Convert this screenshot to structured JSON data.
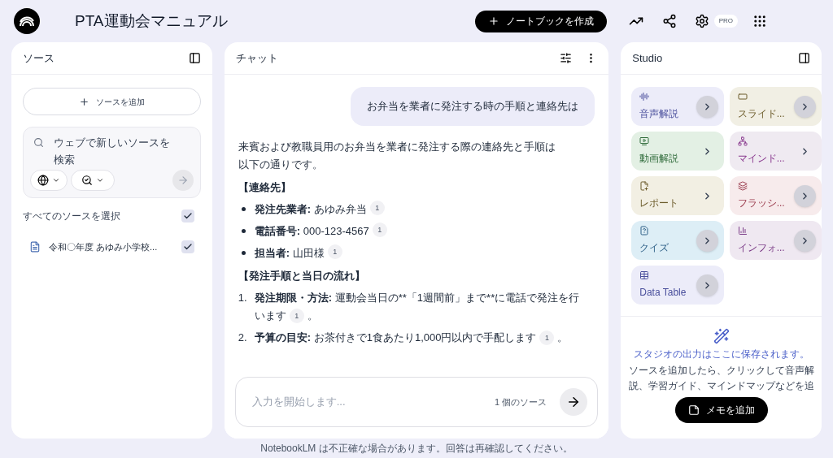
{
  "header": {
    "title": "PTA運動会マニュアル",
    "create_button": "ノートブックを作成",
    "plan_badge": "PRO"
  },
  "sources": {
    "title": "ソース",
    "add_button": "ソースを追加",
    "search": {
      "placeholder": "ウェブで新しいソースを検索"
    },
    "select_all": {
      "label": "すべてのソースを選択",
      "checked": true
    },
    "items": [
      {
        "name": "令和〇年度 あゆみ小学校...",
        "checked": true
      }
    ]
  },
  "chat": {
    "title": "チャット",
    "question": "お弁当を業者に発注する時の手順と連絡先は",
    "intro": "来賓および教職員用のお弁当を業者に発注する際の連絡先と手順は以下の通りです。",
    "heading_contacts": "【連絡先】",
    "contacts": [
      {
        "label": "発注先業者:",
        "value": "あゆみ弁当",
        "cite": "1"
      },
      {
        "label": "電話番号:",
        "value": "000-123-4567",
        "cite": "1"
      },
      {
        "label": "担当者:",
        "value": "山田様",
        "cite": "1"
      }
    ],
    "heading_steps": "【発注手順と当日の流れ】",
    "steps": [
      {
        "number": "1.",
        "label": "発注期限・方法:",
        "value": "運動会当日の**「1週間前」まで**に電話で発注を行います",
        "cite": "1",
        "tail": "。"
      },
      {
        "number": "2.",
        "label": "予算の目安:",
        "value": "お茶付きで1食あたり1,000円以内で手配します",
        "cite": "1",
        "tail": "。"
      }
    ],
    "input": {
      "placeholder": "入力を開始します...",
      "source_count": "1 個のソース"
    }
  },
  "studio": {
    "title": "Studio",
    "tiles": [
      {
        "kind": "audio",
        "label": "音声解説",
        "color": "#ececf9",
        "arrow_circle": true
      },
      {
        "kind": "slides",
        "label": "スライド...",
        "color": "#f1efe4",
        "arrow_circle": true
      },
      {
        "kind": "video",
        "label": "動画解説",
        "color": "#e3f0e4",
        "arrow_circle": false
      },
      {
        "kind": "mindmap",
        "label": "マインド...",
        "color": "#efeaf1",
        "arrow_circle": false
      },
      {
        "kind": "report",
        "label": "レポート",
        "color": "#f2efe3",
        "arrow_circle": false
      },
      {
        "kind": "flashcard",
        "label": "フラッシ...",
        "color": "#f7ebec",
        "arrow_circle": true
      },
      {
        "kind": "quiz",
        "label": "クイズ",
        "color": "#ddeef6",
        "arrow_circle": true
      },
      {
        "kind": "infographic",
        "label": "インフォ...",
        "color": "#efe8f1",
        "arrow_circle": true
      },
      {
        "kind": "table",
        "label": "Data Table",
        "color": "#ececf9",
        "arrow_circle": true
      }
    ],
    "empty_title": "スタジオの出力はここに保存されます。",
    "empty_text": "ソースを追加したら、クリックして音声解説、学習ガイド、マインドマップなどを追",
    "note_button": "メモを追加"
  },
  "footer": "NotebookLM は不正確な場合があります。回答は再確認してください。"
}
